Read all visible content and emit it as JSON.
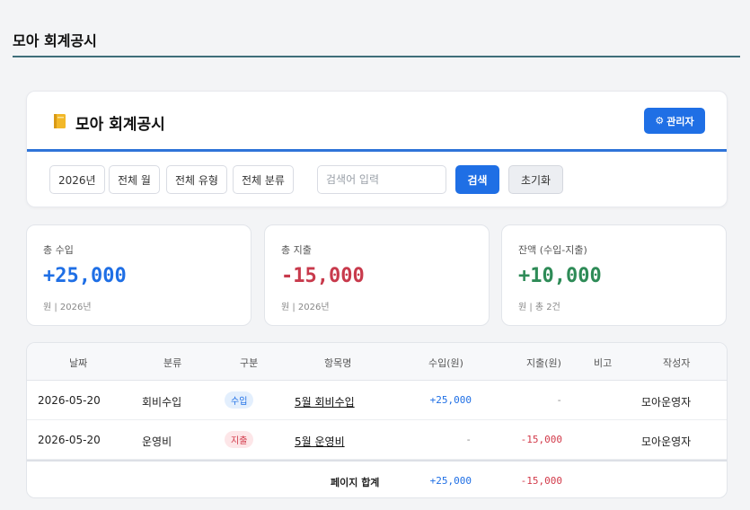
{
  "page": {
    "heading": "모아 회계공시"
  },
  "card": {
    "title": "모아 회계공시",
    "admin_label": "관리자"
  },
  "filters": {
    "year": "2026년",
    "month": "전체 월",
    "type": "전체 유형",
    "category": "전체 분류",
    "search_placeholder": "검색어 입력",
    "search_label": "검색",
    "reset_label": "초기화"
  },
  "stats": {
    "income": {
      "label": "총 수입",
      "value": "+25,000",
      "sub": "원 | 2026년"
    },
    "expense": {
      "label": "총 지출",
      "value": "-15,000",
      "sub": "원 | 2026년"
    },
    "balance": {
      "label": "잔액 (수입-지출)",
      "value": "+10,000",
      "sub": "원 | 총 2건"
    }
  },
  "table": {
    "columns": [
      "날짜",
      "분류",
      "구분",
      "항목명",
      "수입(원)",
      "지출(원)",
      "비고",
      "작성자"
    ],
    "rows": [
      {
        "date": "2026-05-20",
        "category": "회비수입",
        "kind": "수입",
        "item": "5월 회비수입",
        "income": "+25,000",
        "expense": "-",
        "note": "",
        "author": "모아운영자"
      },
      {
        "date": "2026-05-20",
        "category": "운영비",
        "kind": "지출",
        "item": "5월 운영비",
        "income": "-",
        "expense": "-15,000",
        "note": "",
        "author": "모아운영자"
      }
    ],
    "footer": {
      "label": "페이지 합계",
      "income": "+25,000",
      "expense": "-15,000"
    }
  },
  "colors": {
    "accent": "#1f6fe5",
    "income": "#1f6fe5",
    "expense": "#d23a4a",
    "balance": "#2e8b57",
    "header_rule": "#3e6e7a"
  },
  "icons": {
    "title_icon": "book-icon",
    "admin_icon": "gear-icon"
  }
}
